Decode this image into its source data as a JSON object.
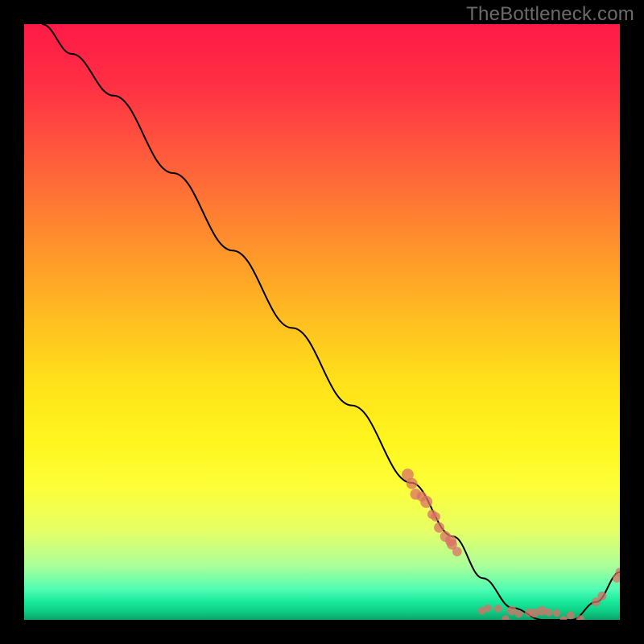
{
  "watermark": {
    "text": "TheBottleneck.com"
  },
  "colors": {
    "background": "#000000",
    "curve": "#000000",
    "dots": "#d97066",
    "gradient_top": "#ff1a46",
    "gradient_bottom": "#0aa56b"
  },
  "chart_data": {
    "type": "line",
    "title": "",
    "xlabel": "",
    "ylabel": "",
    "xlim": [
      0,
      100
    ],
    "ylim": [
      0,
      100
    ],
    "grid": false,
    "series": [
      {
        "name": "curve",
        "x": [
          3,
          8,
          15,
          25,
          35,
          45,
          55,
          65,
          72,
          77,
          82,
          87,
          92,
          96,
          100
        ],
        "y": [
          100,
          95,
          88,
          75,
          62,
          49,
          36,
          23,
          14,
          7,
          2,
          0,
          0,
          3,
          8
        ]
      }
    ],
    "scatter_cluster_left": {
      "x_range": [
        64,
        73
      ],
      "y_range": [
        11,
        24
      ],
      "count": 12
    },
    "scatter_cluster_bottom": {
      "x_range": [
        77,
        93
      ],
      "y_range": [
        0,
        2
      ],
      "count": 14
    },
    "scatter_cluster_right": {
      "points": [
        {
          "x": 96,
          "y": 3
        },
        {
          "x": 97,
          "y": 4
        },
        {
          "x": 99.5,
          "y": 7
        },
        {
          "x": 100,
          "y": 8
        }
      ]
    }
  }
}
